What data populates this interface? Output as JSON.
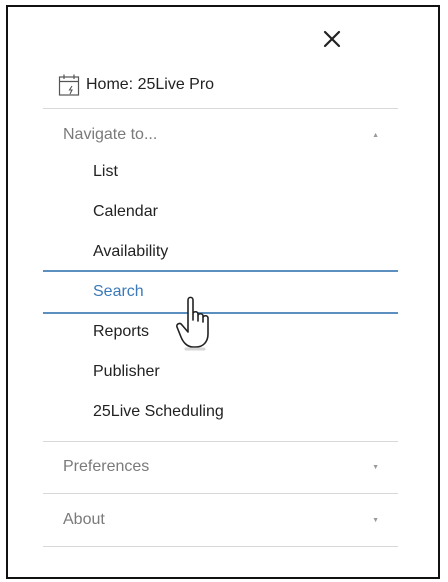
{
  "close_label": "✕",
  "home": {
    "label": "Home: 25Live Pro",
    "icon": "calendar-icon"
  },
  "navigate": {
    "header": "Navigate to...",
    "expanded": true,
    "items": [
      {
        "label": "List",
        "active": false
      },
      {
        "label": "Calendar",
        "active": false
      },
      {
        "label": "Availability",
        "active": false
      },
      {
        "label": "Search",
        "active": true
      },
      {
        "label": "Reports",
        "active": false
      },
      {
        "label": "Publisher",
        "active": false
      },
      {
        "label": "25Live Scheduling",
        "active": false
      }
    ]
  },
  "preferences": {
    "header": "Preferences",
    "expanded": false
  },
  "about": {
    "header": "About",
    "expanded": false
  },
  "colors": {
    "active_text": "#3a7ab8",
    "active_line": "#5b8fbf",
    "divider": "#d8d8d8",
    "muted_text": "#7a7a7a"
  }
}
